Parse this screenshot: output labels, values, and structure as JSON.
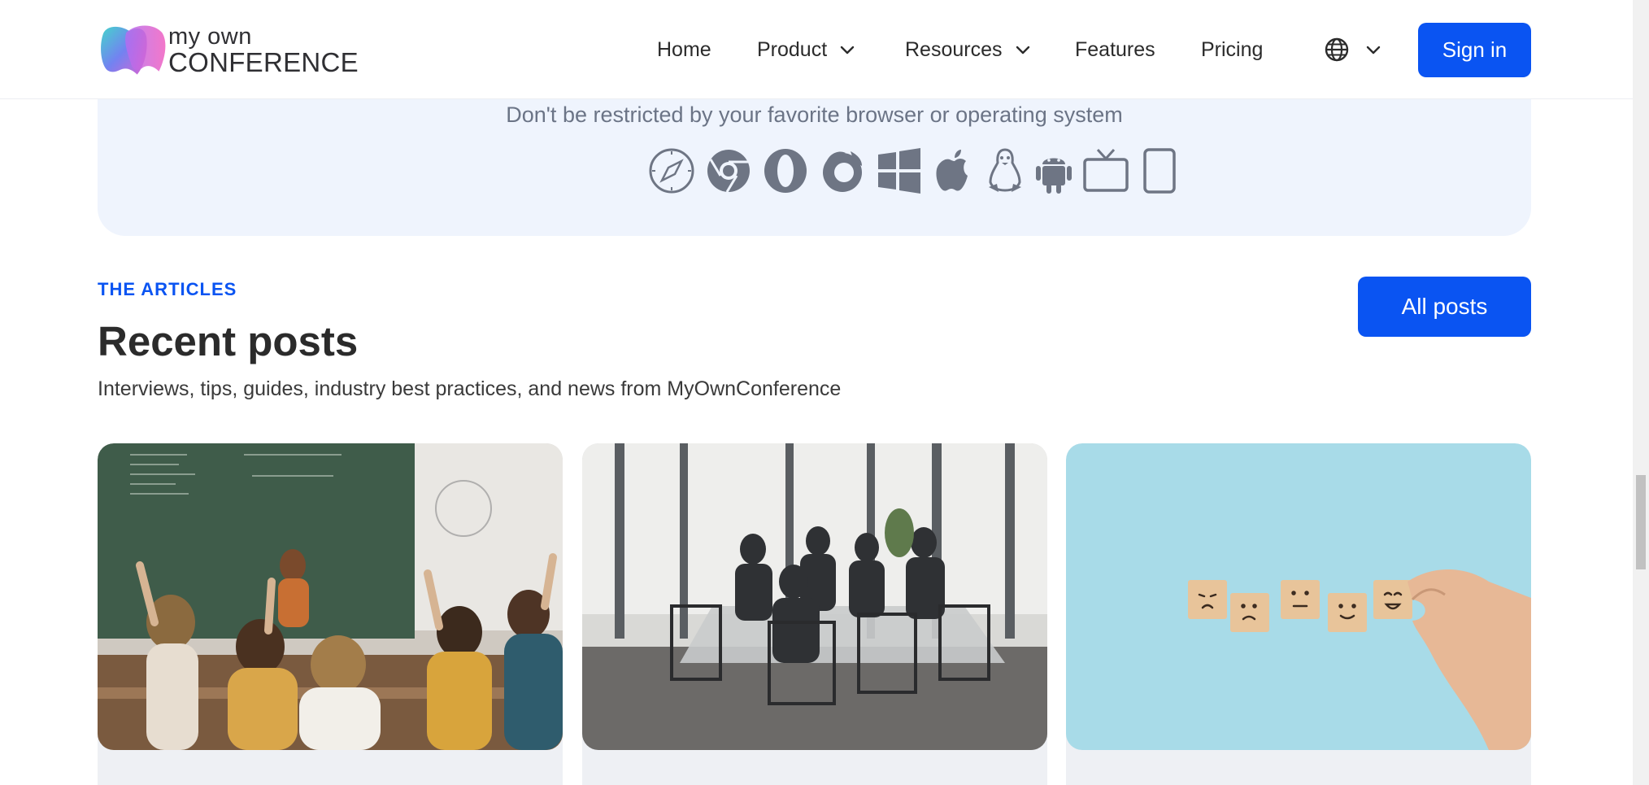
{
  "header": {
    "logo": {
      "line1": "my own",
      "line2": "CONFERENCE"
    },
    "nav": [
      {
        "label": "Home",
        "has_dropdown": false
      },
      {
        "label": "Product",
        "has_dropdown": true
      },
      {
        "label": "Resources",
        "has_dropdown": true
      },
      {
        "label": "Features",
        "has_dropdown": false
      },
      {
        "label": "Pricing",
        "has_dropdown": false
      }
    ],
    "language_icon": "globe-icon",
    "signin_label": "Sign in"
  },
  "platforms": {
    "text": "Don't be restricted by your favorite browser or operating system",
    "icons": [
      "safari-icon",
      "chrome-icon",
      "opera-icon",
      "firefox-icon",
      "windows-icon",
      "apple-icon",
      "linux-icon",
      "android-icon",
      "tv-icon",
      "tablet-icon"
    ]
  },
  "articles": {
    "eyebrow": "THE ARTICLES",
    "title": "Recent posts",
    "subtitle": "Interviews, tips, guides, industry best practices, and news from MyOwnConference",
    "all_posts_label": "All posts",
    "cards": [
      {
        "image": "classroom-photo"
      },
      {
        "image": "meeting-room-photo"
      },
      {
        "image": "emoji-blocks-photo"
      }
    ]
  },
  "colors": {
    "accent": "#0a54f2",
    "band_bg": "#eff4fd",
    "icon": "#6e7584"
  }
}
